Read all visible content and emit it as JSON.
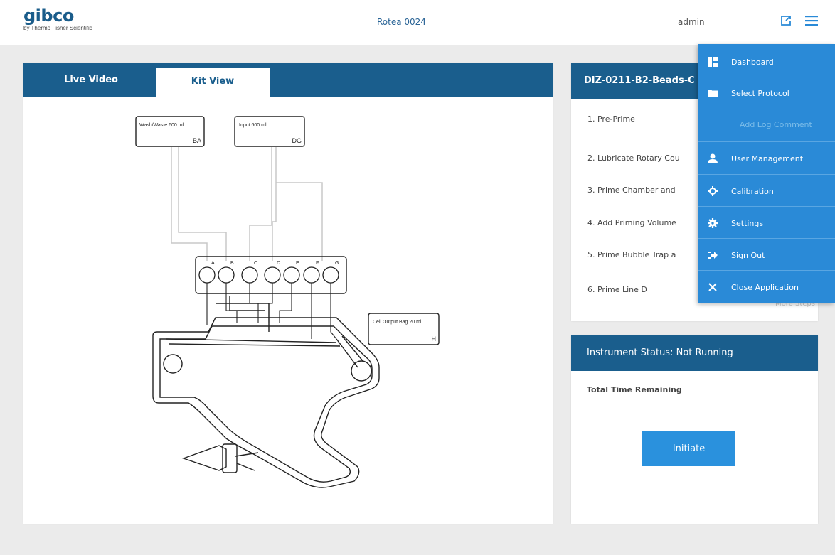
{
  "header": {
    "logo": "gibco",
    "logo_sub": "by Thermo Fisher Scientific",
    "device": "Rotea 0024",
    "user": "admin"
  },
  "tabs": [
    {
      "label": "Live Video"
    },
    {
      "label": "Kit View"
    }
  ],
  "kit": {
    "bag_wash": {
      "name": "Wash/Waste 600 ml",
      "port": "BA"
    },
    "bag_input": {
      "name": "Input 600 ml",
      "port": "DG"
    },
    "bag_output": {
      "name": "Cell Output Bag 20 ml",
      "port": "H"
    },
    "valves": [
      "A",
      "B",
      "C",
      "D",
      "E",
      "F",
      "G"
    ]
  },
  "protocol": {
    "title": "DIZ-0211-B2-Beads-C",
    "steps": [
      "1.  Pre-Prime",
      "2.  Lubricate Rotary Cou",
      "3.  Prime Chamber and",
      "4.  Add Priming Volume",
      "5.  Prime Bubble Trap a",
      "6.  Prime Line D"
    ],
    "more": "More Steps"
  },
  "status": {
    "title": "Instrument Status: Not Running",
    "time_label": "Total Time Remaining",
    "initiate": "Initiate"
  },
  "menu": [
    {
      "label": "Dashboard",
      "icon": "dashboard-icon",
      "enabled": true
    },
    {
      "label": "Select Protocol",
      "icon": "folder-icon",
      "enabled": true
    },
    {
      "label": "Add Log Comment",
      "icon": "",
      "enabled": false
    },
    {
      "label": "User Management",
      "icon": "user-icon",
      "enabled": true
    },
    {
      "label": "Calibration",
      "icon": "crosshair-icon",
      "enabled": true
    },
    {
      "label": "Settings",
      "icon": "gear-icon",
      "enabled": true
    },
    {
      "label": "Sign Out",
      "icon": "sign-out-icon",
      "enabled": true
    },
    {
      "label": "Close Application",
      "icon": "close-icon",
      "enabled": true
    }
  ],
  "colors": {
    "header_blue": "#1a5e8d",
    "menu_blue": "#2a8ad7",
    "button_blue": "#2a91dd",
    "background": "#ebebeb"
  }
}
